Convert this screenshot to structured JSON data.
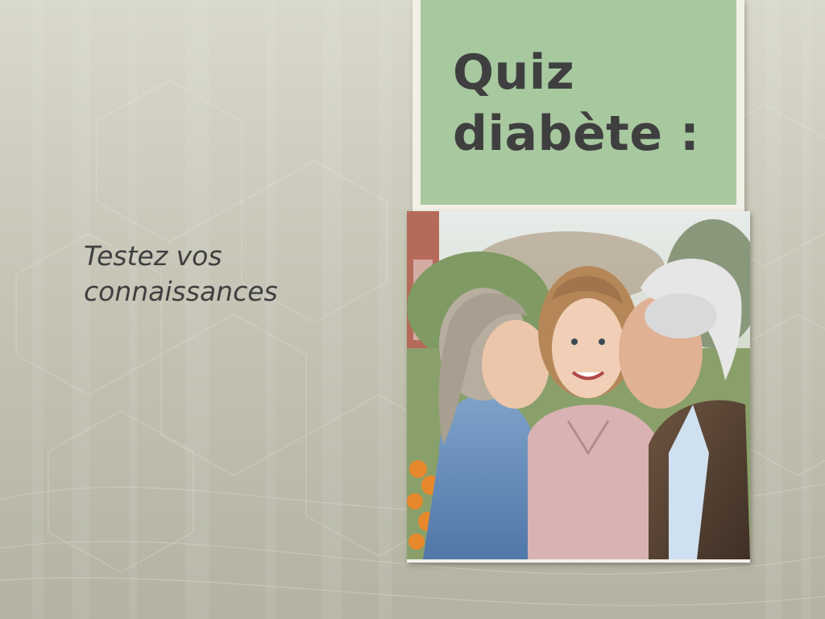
{
  "slide": {
    "title_line1": "Quiz",
    "title_line2": "diabète :",
    "subtitle_line1": "Testez vos",
    "subtitle_line2": "connaissances"
  },
  "photo": {
    "description_icon": "family-photo"
  },
  "colors": {
    "title_box": "#a8c8a0",
    "title_text": "#3f3f3f",
    "background": "#c6c5b6"
  }
}
